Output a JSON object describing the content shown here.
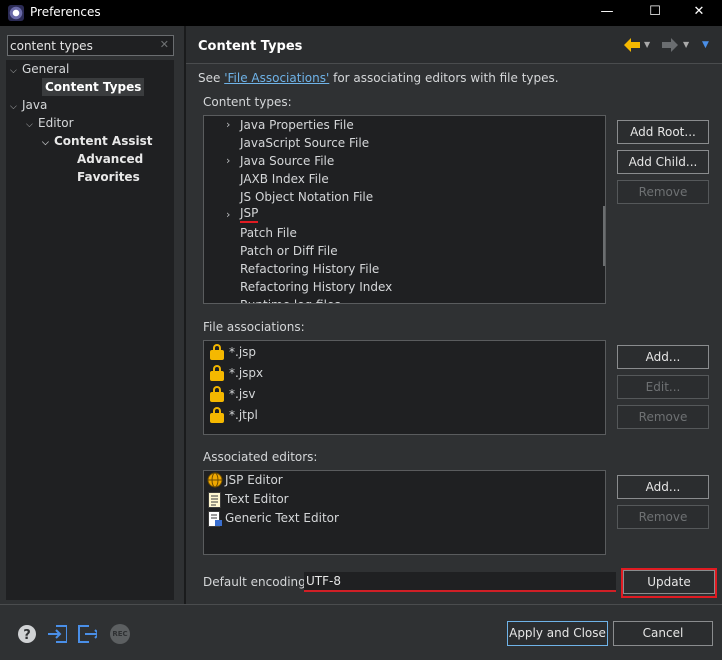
{
  "window": {
    "title": "Preferences",
    "minimize": "—",
    "maximize": "☐",
    "close": "✕"
  },
  "filter": {
    "value": "content types",
    "clear": "✕"
  },
  "tree": [
    {
      "label": "General",
      "toggle": "⌵"
    },
    {
      "label": "Content Types"
    },
    {
      "label": "Java",
      "toggle": "⌵"
    },
    {
      "label": "Editor",
      "toggle": "⌵"
    },
    {
      "label": "Content Assist",
      "toggle": "⌵"
    },
    {
      "label": "Advanced"
    },
    {
      "label": "Favorites"
    }
  ],
  "page": {
    "title": "Content Types",
    "see_prefix": "See ",
    "see_link": "'File Associations'",
    "see_suffix": " for associating editors with file types."
  },
  "content_types": {
    "label": "Content types:",
    "items": [
      {
        "label": "Java Properties File",
        "expander": "›"
      },
      {
        "label": "JavaScript Source File",
        "expander": ""
      },
      {
        "label": "Java Source File",
        "expander": "›"
      },
      {
        "label": "JAXB Index File",
        "expander": ""
      },
      {
        "label": "JS Object Notation File",
        "expander": ""
      },
      {
        "label": "JSP",
        "expander": "›",
        "selected": true
      },
      {
        "label": "Patch File",
        "expander": ""
      },
      {
        "label": "Patch or Diff File",
        "expander": ""
      },
      {
        "label": "Refactoring History File",
        "expander": ""
      },
      {
        "label": "Refactoring History Index",
        "expander": ""
      },
      {
        "label": "Runtime log files",
        "expander": ""
      }
    ],
    "buttons": {
      "add_root": "Add Root...",
      "add_child": "Add Child...",
      "remove": "Remove"
    }
  },
  "file_associations": {
    "label": "File associations:",
    "items": [
      "*.jsp",
      "*.jspx",
      "*.jsv",
      "*.jtpl"
    ],
    "buttons": {
      "add": "Add...",
      "edit": "Edit...",
      "remove": "Remove"
    }
  },
  "associated_editors": {
    "label": "Associated editors:",
    "items": [
      "JSP Editor",
      "Text Editor",
      "Generic Text Editor"
    ],
    "buttons": {
      "add": "Add...",
      "remove": "Remove"
    }
  },
  "encoding": {
    "label": "Default encoding:",
    "value": "UTF-8",
    "update": "Update"
  },
  "footer": {
    "apply_close": "Apply and Close",
    "cancel": "Cancel",
    "rec": "REC"
  },
  "colors": {
    "accent_red": "#e01b22",
    "link": "#6fb3e8",
    "lock": "#f5b800",
    "nav_back": "#f5b800",
    "menu_blue": "#4a8fe8"
  }
}
